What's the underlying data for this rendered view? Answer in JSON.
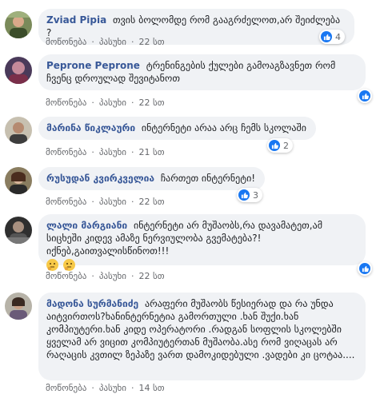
{
  "actions": {
    "like": "მოწონება",
    "reply": "პასუხი"
  },
  "comments": [
    {
      "author": "Zviad Pipia",
      "text": "თვის ბოლომდე რომ გააგრძელოთ,არ შეიძლება ?",
      "time": "22 სთ",
      "reactions": "4"
    },
    {
      "author": "Peprone Peprone",
      "text": "ტრენინგების ქულები გამოაგზავნეთ რომ ჩვენც დროულად შევიტანოთ",
      "time": "22 სთ",
      "reactions": ""
    },
    {
      "author": "მარინა წიკლაური",
      "text": "ინტერნეტი არაა არც ჩემს სკოლაში",
      "time": "21 სთ",
      "reactions": "2"
    },
    {
      "author": "რუსუდან კვირკველია",
      "text": "ჩართეთ ინტერნეტი!",
      "time": "22 სთ",
      "reactions": "3"
    },
    {
      "author": "ლალი მარგიანი",
      "text": "ინტერნეტი არ მუშაობს,რა დავამატეთ,ამ სიცხეში კიდევ ამაზე ნერვიულობა გვემატება?! იქნებ,გაითვალისწინოთ!!!",
      "time": "22 სთ",
      "reactions": ""
    },
    {
      "author": "მადონა სურმანიძე",
      "text": "არაფერი მუშაობს წესიერად და რა უნდა აიტვირთოს?ხანინტერნეტია გამორთული .ხან შუქი.ხან კომპიუტერი.ხან კიდე ოპერატორი .რადგან სოფლის სკოლებში ყველამ არ ვიცით კომპიუტერთან მუშაობა.ასე რომ ვიღაცას არ რაღაცის კვთილ ზეპაზე ვართ დამოკიდებული .ვადები კი ცოტაა....",
      "time": "14 სთ",
      "reactions": ""
    }
  ],
  "colors": {
    "author": "#385898",
    "bubble": "#f0f2f5",
    "like": "#1877f2",
    "meta": "#65676b"
  }
}
